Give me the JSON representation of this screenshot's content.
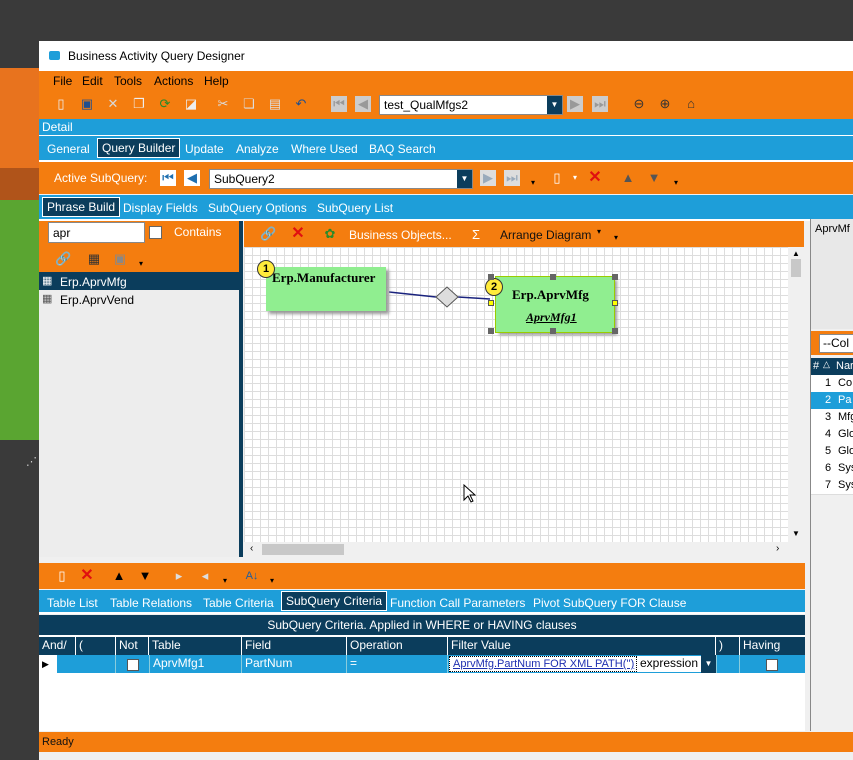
{
  "window": {
    "title": "Business Activity Query Designer"
  },
  "menu": [
    "File",
    "Edit",
    "Tools",
    "Actions",
    "Help"
  ],
  "toolbar": {
    "query_name": "test_QualMfgs2"
  },
  "detail_label": "Detail",
  "main_tabs": [
    "General",
    "Query Builder",
    "Update",
    "Analyze",
    "Where Used",
    "BAQ Search"
  ],
  "subquery_bar": {
    "label": "Active SubQuery:",
    "value": "SubQuery2"
  },
  "sub_tabs": [
    "Phrase Build",
    "Display Fields",
    "SubQuery Options",
    "SubQuery List"
  ],
  "search": {
    "value": "apr",
    "contains_label": "Contains"
  },
  "tables_list": [
    "Erp.AprvMfg",
    "Erp.AprvVend"
  ],
  "diagram_toolbar": {
    "business_objects": "Business Objects...",
    "sigma": "Σ",
    "arrange": "Arrange Diagram"
  },
  "diagram": {
    "node1": {
      "badge": "1",
      "title": "Erp.Manufacturer"
    },
    "node2": {
      "badge": "2",
      "title": "Erp.AprvMfg",
      "alias": "AprvMfg1"
    }
  },
  "right_panel": {
    "title": "AprvMf",
    "combo": "--Col",
    "header_num": "#",
    "header_name": "Nar",
    "rows": [
      {
        "n": "1",
        "t": "Co"
      },
      {
        "n": "2",
        "t": "Pa"
      },
      {
        "n": "3",
        "t": "Mfg"
      },
      {
        "n": "4",
        "t": "Glo"
      },
      {
        "n": "5",
        "t": "Glo"
      },
      {
        "n": "6",
        "t": "Sys"
      },
      {
        "n": "7",
        "t": "Sys"
      }
    ]
  },
  "bottom_tabs": [
    "Table List",
    "Table Relations",
    "Table Criteria",
    "SubQuery Criteria",
    "Function Call Parameters",
    "Pivot SubQuery FOR Clause"
  ],
  "criteria": {
    "caption": "SubQuery Criteria. Applied in WHERE or HAVING clauses",
    "headers": [
      "And/",
      "(",
      "Not",
      "Table",
      "Field",
      "Operation",
      "Filter Value",
      ")",
      "Having"
    ],
    "row": {
      "table": "AprvMfg1",
      "field": "PartNum",
      "operation": "=",
      "filter": "AprvMfg.PartNum FOR XML PATH('')",
      "type": "expression"
    }
  },
  "status": "Ready",
  "colors": {
    "orange": "#f47d0f",
    "blue": "#1e9ed9",
    "navy": "#0b3d5c",
    "node": "#90ee90"
  }
}
